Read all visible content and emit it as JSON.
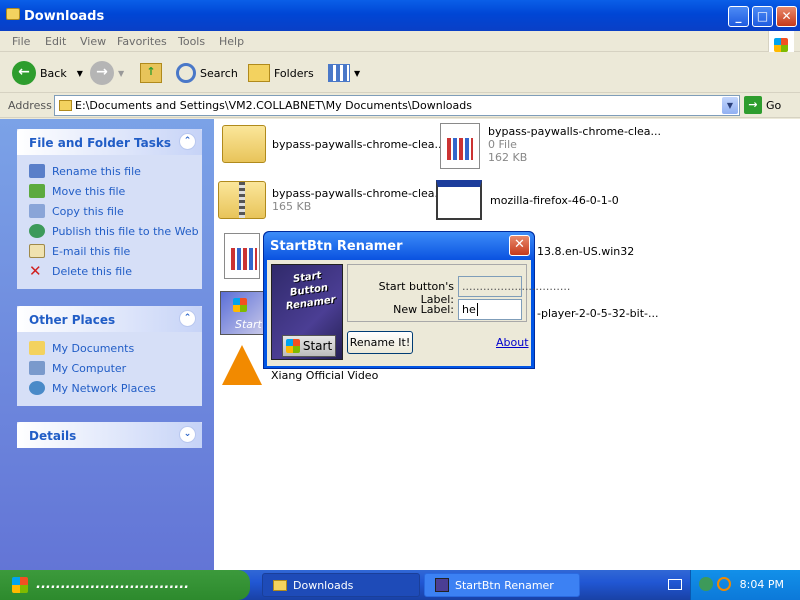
{
  "window": {
    "title": "Downloads"
  },
  "menu": [
    "File",
    "Edit",
    "View",
    "Favorites",
    "Tools",
    "Help"
  ],
  "toolbar": {
    "back": "Back",
    "search": "Search",
    "folders": "Folders"
  },
  "address": {
    "label": "Address",
    "value": "E:\\Documents and Settings\\VM2.COLLABNET\\My Documents\\Downloads",
    "go": "Go"
  },
  "tasks_panel": {
    "title": "File and Folder Tasks",
    "items": [
      "Rename this file",
      "Move this file",
      "Copy this file",
      "Publish this file to the Web",
      "E-mail this file",
      "Delete this file"
    ]
  },
  "places_panel": {
    "title": "Other Places",
    "items": [
      "My Documents",
      "My Computer",
      "My Network Places"
    ]
  },
  "details_panel": {
    "title": "Details"
  },
  "files": [
    {
      "name": "bypass-paywalls-chrome-clea...",
      "meta1": "",
      "meta2": ""
    },
    {
      "name": "bypass-paywalls-chrome-clea...",
      "meta1": "0 File",
      "meta2": "162 KB"
    },
    {
      "name": "bypass-paywalls-chrome-clea...",
      "meta1": "165 KB",
      "meta2": ""
    },
    {
      "name": "mozilla-firefox-46-0-1-0",
      "meta1": "",
      "meta2": ""
    },
    {
      "name": "13.8.en-US.win32",
      "meta1": "",
      "meta2": ""
    },
    {
      "name": "-player-2-0-5-32-bit-...",
      "meta1": "",
      "meta2": ""
    },
    {
      "name": "Xiang Official Video",
      "meta1": "",
      "meta2": ""
    },
    {
      "name": "Start",
      "meta1": "",
      "meta2": ""
    }
  ],
  "dialog": {
    "title": "StartBtn Renamer",
    "logo_text": "Start Button Renamer",
    "start_button": "Start",
    "label_current": "Start button's Label:",
    "label_new": "New Label:",
    "current_value": "...............................",
    "new_value": "he",
    "rename_button": "Rename It!",
    "about_link": "About"
  },
  "taskbar": {
    "start_label": "...............................",
    "items": [
      "Downloads",
      "StartBtn Renamer"
    ],
    "clock": "8:04 PM"
  }
}
